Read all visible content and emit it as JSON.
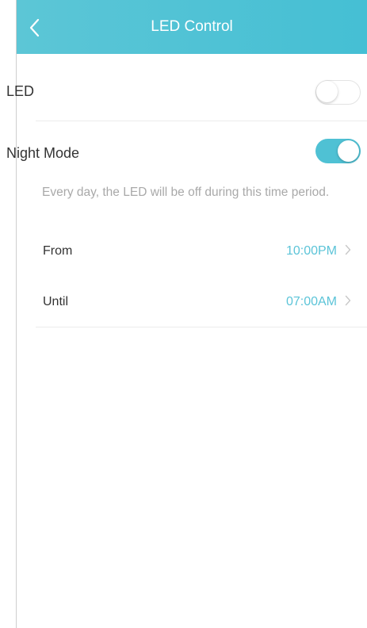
{
  "header": {
    "title": "LED Control",
    "back_icon": "chevron-left-icon",
    "background": "#4fc1d4"
  },
  "led": {
    "label": "LED",
    "enabled": false
  },
  "night_mode": {
    "label": "Night Mode",
    "enabled": true,
    "description": "Every day, the LED will be off during this time period."
  },
  "schedule": {
    "from_label": "From",
    "from_value": "10:00PM",
    "until_label": "Until",
    "until_value": "07:00AM",
    "value_color": "#5cc4d8",
    "chevron_icon": "chevron-right-icon"
  }
}
